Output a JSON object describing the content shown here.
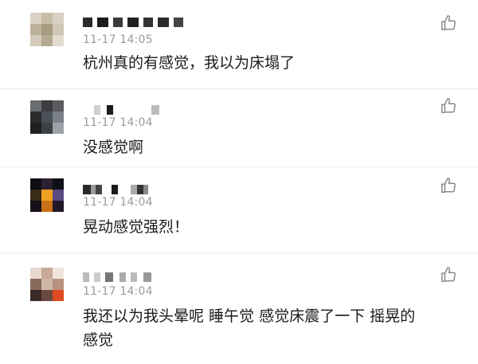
{
  "comments": [
    {
      "time": "11-17 14:05",
      "text": "杭州真的有感觉，我以为床塌了"
    },
    {
      "time": "11-17 14:04",
      "text": "没感觉啊"
    },
    {
      "time": "11-17 14:04",
      "text": "晃动感觉强烈！"
    },
    {
      "time": "11-17 14:04",
      "text": "我还以为我头晕呢 睡午觉 感觉床震了一下 摇晃的感觉"
    }
  ],
  "icons": {
    "like": "thumbs-up-icon"
  },
  "colors": {
    "time": "#9b9b9b",
    "divider": "#ececec",
    "icon": "#888888"
  }
}
